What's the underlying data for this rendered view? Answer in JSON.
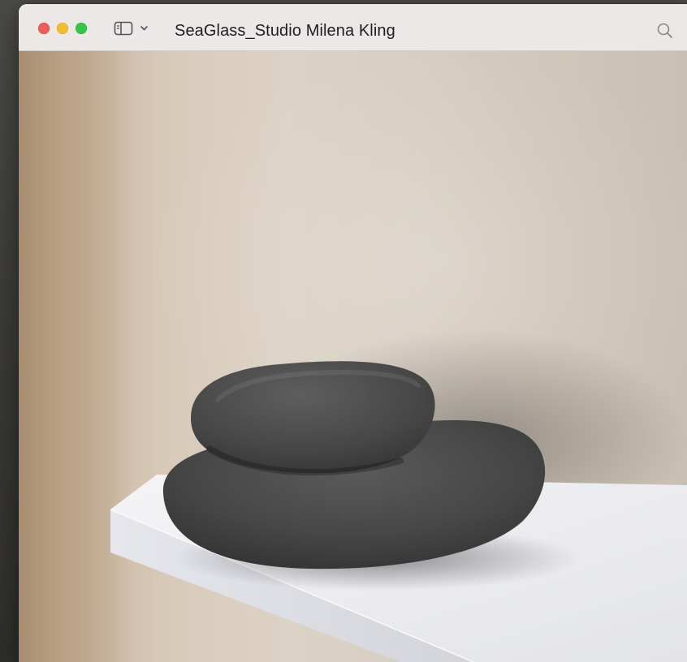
{
  "window": {
    "title": "SeaGlass_Studio Milena Kling",
    "controls": {
      "close": "close-button",
      "minimize": "minimize-button",
      "zoom": "zoom-button"
    },
    "sidebar_toggle_icon": "sidebar-icon",
    "dropdown_icon": "chevron-down-icon",
    "search_icon": "search-icon"
  },
  "colors": {
    "titlebar": "#ece8e8",
    "close": "#ec5f57",
    "minimize": "#f3bd31",
    "zoom": "#33c748",
    "stone": "#4a4a4a",
    "shelf": "#f0f0f2",
    "wall": "#dcd2c5"
  },
  "content": {
    "image": "photo-stacked-stones-on-shelf"
  }
}
